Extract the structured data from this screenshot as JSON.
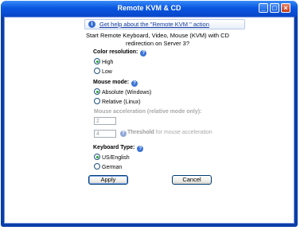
{
  "window": {
    "title": "Remote KVM & CD"
  },
  "help": {
    "link_text": "Get help about the \"Remote KVM \" action"
  },
  "intro": {
    "text": "Start Remote Keyboard, Video, Mouse (KVM) with CD redirection on Server 3?"
  },
  "color_resolution": {
    "label": "Color resolution:",
    "options": [
      "High",
      "Low"
    ],
    "selected": "High"
  },
  "mouse_mode": {
    "label": "Mouse mode:",
    "options": [
      "Absolute (Windows)",
      "Relative (Linux)"
    ],
    "selected": "Absolute (Windows)"
  },
  "mouse_acceleration": {
    "label": "Mouse acceleration (relative mode only):",
    "value": "2"
  },
  "threshold": {
    "value": "4",
    "label_bold": "Threshold",
    "label_rest": " for mouse acceleration"
  },
  "keyboard_type": {
    "label": "Keyboard Type:",
    "options": [
      "US/English",
      "German"
    ],
    "selected": "US/English"
  },
  "buttons": {
    "apply": "Apply",
    "cancel": "Cancel"
  },
  "colors": {
    "title_bar": "#0a56e0",
    "window_frame": "#0a3ea8",
    "radio_checked": "#21a121",
    "link": "#1a3fa0"
  }
}
